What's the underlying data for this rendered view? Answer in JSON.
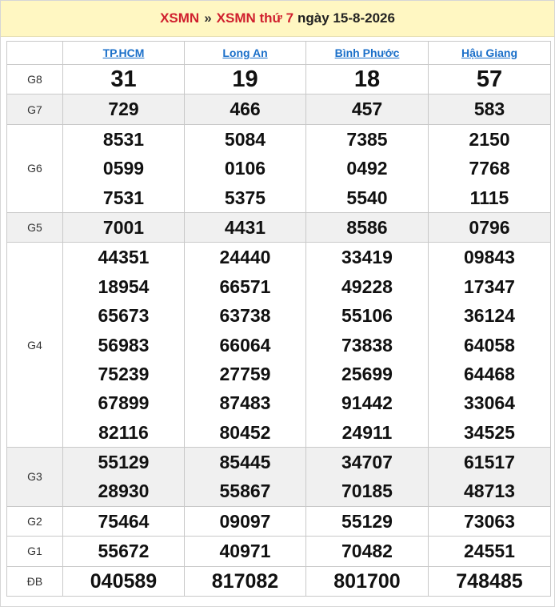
{
  "header": {
    "link1": "XSMN",
    "separator": "»",
    "link2": "XSMN thứ 7",
    "date_text": "ngày 15-8-2026"
  },
  "provinces": [
    "TP.HCM",
    "Long An",
    "Bình Phước",
    "Hậu Giang"
  ],
  "rows": [
    {
      "label": "G8",
      "values": [
        [
          "31"
        ],
        [
          "19"
        ],
        [
          "18"
        ],
        [
          "57"
        ]
      ]
    },
    {
      "label": "G7",
      "values": [
        [
          "729"
        ],
        [
          "466"
        ],
        [
          "457"
        ],
        [
          "583"
        ]
      ]
    },
    {
      "label": "G6",
      "values": [
        [
          "8531",
          "0599",
          "7531"
        ],
        [
          "5084",
          "0106",
          "5375"
        ],
        [
          "7385",
          "0492",
          "5540"
        ],
        [
          "2150",
          "7768",
          "1115"
        ]
      ]
    },
    {
      "label": "G5",
      "values": [
        [
          "7001"
        ],
        [
          "4431"
        ],
        [
          "8586"
        ],
        [
          "0796"
        ]
      ]
    },
    {
      "label": "G4",
      "values": [
        [
          "44351",
          "18954",
          "65673",
          "56983",
          "75239",
          "67899",
          "82116"
        ],
        [
          "24440",
          "66571",
          "63738",
          "66064",
          "27759",
          "87483",
          "80452"
        ],
        [
          "33419",
          "49228",
          "55106",
          "73838",
          "25699",
          "91442",
          "24911"
        ],
        [
          "09843",
          "17347",
          "36124",
          "64058",
          "64468",
          "33064",
          "34525"
        ]
      ]
    },
    {
      "label": "G3",
      "values": [
        [
          "55129",
          "28930"
        ],
        [
          "85445",
          "55867"
        ],
        [
          "34707",
          "70185"
        ],
        [
          "61517",
          "48713"
        ]
      ]
    },
    {
      "label": "G2",
      "values": [
        [
          "75464"
        ],
        [
          "09097"
        ],
        [
          "55129"
        ],
        [
          "73063"
        ]
      ]
    },
    {
      "label": "G1",
      "values": [
        [
          "55672"
        ],
        [
          "40971"
        ],
        [
          "70482"
        ],
        [
          "24551"
        ]
      ]
    },
    {
      "label": "ĐB",
      "values": [
        [
          "040589"
        ],
        [
          "817082"
        ],
        [
          "801700"
        ],
        [
          "748485"
        ]
      ]
    }
  ],
  "colors": {
    "header_bg": "#fff7c2",
    "link_red": "#d0202e",
    "province_blue": "#1a6fc9",
    "prize_red": "#e0202e",
    "row_shade": "#f0f0f0"
  }
}
